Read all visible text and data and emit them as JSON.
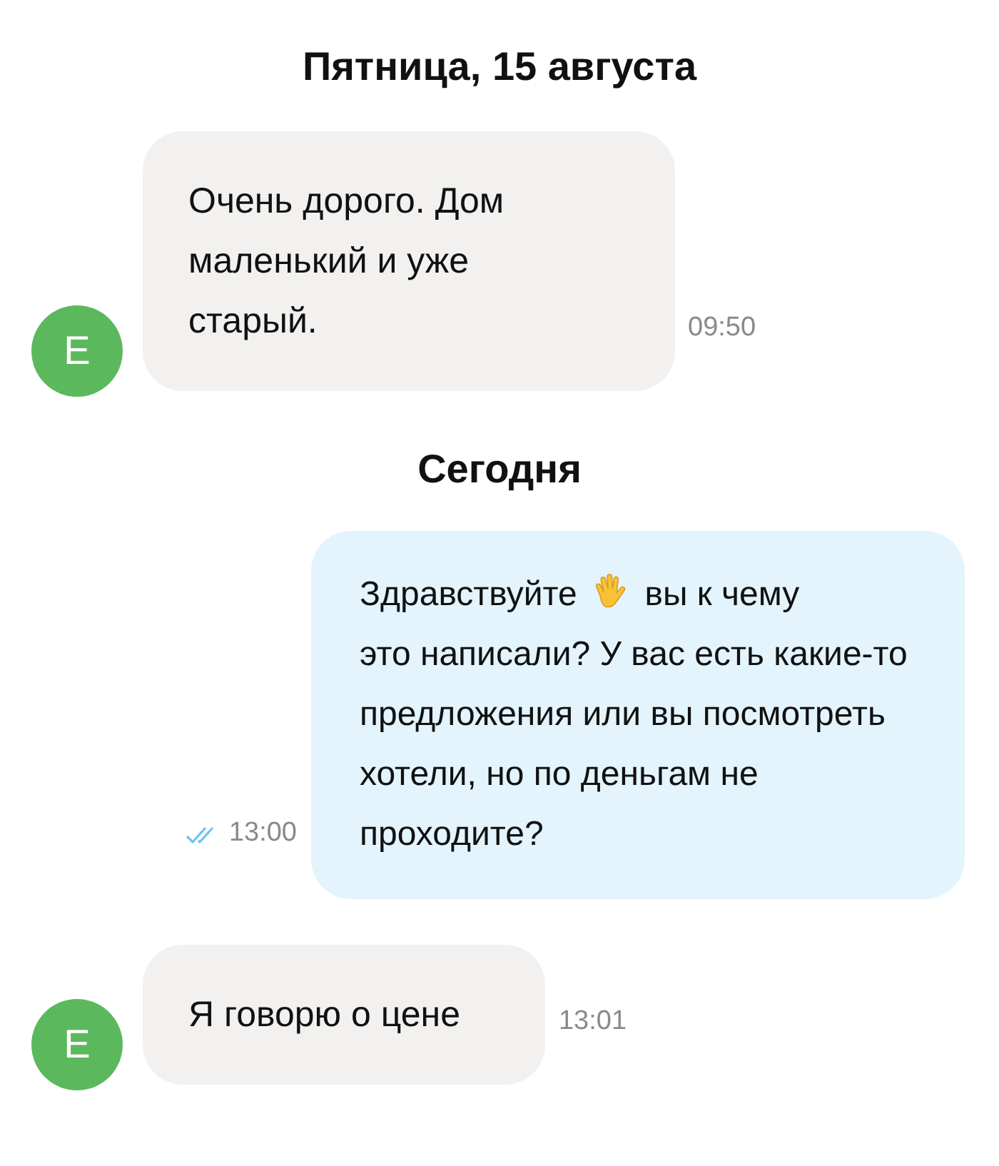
{
  "items": [
    {
      "kind": "date",
      "text": "Пятница, 15 августа"
    },
    {
      "kind": "incoming",
      "avatar": "E",
      "color": "#5cb85c",
      "parts": [
        {
          "kind": "text",
          "text": "Очень дорого. Дом маленький и уже старый."
        }
      ],
      "time": "09:50"
    },
    {
      "kind": "date",
      "text": "Сегодня"
    },
    {
      "kind": "outgoing",
      "read": true,
      "parts": [
        {
          "kind": "text",
          "text": "Здравствуйте"
        },
        {
          "kind": "wave"
        },
        {
          "kind": "text",
          "text": "вы к чему"
        },
        {
          "kind": "paragraph",
          "text": "это написали? У вас есть какие-то предложения или вы посмотреть хотели, но по деньгам не проходите?"
        }
      ],
      "time": "13:00"
    },
    {
      "kind": "incoming",
      "avatar": "E",
      "color": "#5cb85c",
      "parts": [
        {
          "kind": "text",
          "text": "Я говорю о цене"
        }
      ],
      "time": "13:01"
    }
  ]
}
